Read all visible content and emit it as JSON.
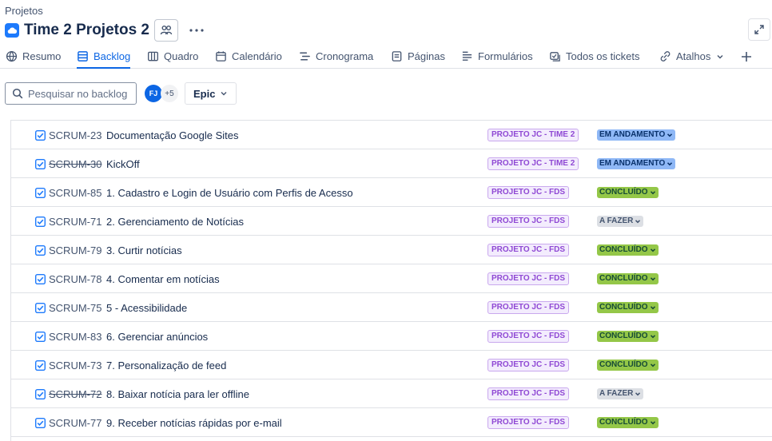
{
  "breadcrumb": "Projetos",
  "project": {
    "title": "Time 2 Projetos 2"
  },
  "tabs": [
    {
      "label": "Resumo",
      "icon": "globe-icon"
    },
    {
      "label": "Backlog",
      "icon": "backlog-icon",
      "active": true
    },
    {
      "label": "Quadro",
      "icon": "board-icon"
    },
    {
      "label": "Calendário",
      "icon": "calendar-icon"
    },
    {
      "label": "Cronograma",
      "icon": "timeline-icon"
    },
    {
      "label": "Páginas",
      "icon": "pages-icon"
    },
    {
      "label": "Formulários",
      "icon": "forms-icon"
    },
    {
      "label": "Todos os tickets",
      "icon": "tickets-icon"
    },
    {
      "label": "Atalhos",
      "icon": "link-icon"
    }
  ],
  "toolbar": {
    "search_placeholder": "Pesquisar no backlog",
    "avatar_initials": "FJ",
    "avatar_more": "+5",
    "epic_label": "Epic"
  },
  "colors": {
    "accent": "#0c66e4",
    "done": "#94c748",
    "in_progress": "#8fb8f6",
    "todo": "#dcdfe4",
    "epic": "#8f48d4"
  },
  "issues": [
    {
      "key": "SCRUM-23",
      "summary": "Documentação Google Sites",
      "epic": "PROJETO JC - TIME 2",
      "status": "EM ANDAMENTO",
      "status_type": "progress",
      "key_struck": false
    },
    {
      "key": "SCRUM-30",
      "summary": "KickOff",
      "epic": "PROJETO JC - TIME 2",
      "status": "EM ANDAMENTO",
      "status_type": "progress",
      "key_struck": true
    },
    {
      "key": "SCRUM-85",
      "summary": "1. Cadastro e Login de Usuário com Perfis de Acesso",
      "epic": "PROJETO JC - FDS",
      "status": "CONCLUÍDO",
      "status_type": "done",
      "key_struck": false
    },
    {
      "key": "SCRUM-71",
      "summary": "2. Gerenciamento de Notícias",
      "epic": "PROJETO JC - FDS",
      "status": "A FAZER",
      "status_type": "todo",
      "key_struck": false
    },
    {
      "key": "SCRUM-79",
      "summary": "3. Curtir notícias",
      "epic": "PROJETO JC - FDS",
      "status": "CONCLUÍDO",
      "status_type": "done",
      "key_struck": false
    },
    {
      "key": "SCRUM-78",
      "summary": "4. Comentar em notícias",
      "epic": "PROJETO JC - FDS",
      "status": "CONCLUÍDO",
      "status_type": "done",
      "key_struck": false
    },
    {
      "key": "SCRUM-75",
      "summary": "5 - Acessibilidade",
      "epic": "PROJETO JC - FDS",
      "status": "CONCLUÍDO",
      "status_type": "done",
      "key_struck": false
    },
    {
      "key": "SCRUM-83",
      "summary": "6. Gerenciar anúncios",
      "epic": "PROJETO JC - FDS",
      "status": "CONCLUÍDO",
      "status_type": "done",
      "key_struck": false
    },
    {
      "key": "SCRUM-73",
      "summary": "7. Personalização de feed",
      "epic": "PROJETO JC - FDS",
      "status": "CONCLUÍDO",
      "status_type": "done",
      "key_struck": false
    },
    {
      "key": "SCRUM-72",
      "summary": "8. Baixar notícia para ler offline",
      "epic": "PROJETO JC - FDS",
      "status": "A FAZER",
      "status_type": "todo",
      "key_struck": true
    },
    {
      "key": "SCRUM-77",
      "summary": "9. Receber notícias rápidas por e-mail",
      "epic": "PROJETO JC - FDS",
      "status": "CONCLUÍDO",
      "status_type": "done",
      "key_struck": false
    }
  ]
}
